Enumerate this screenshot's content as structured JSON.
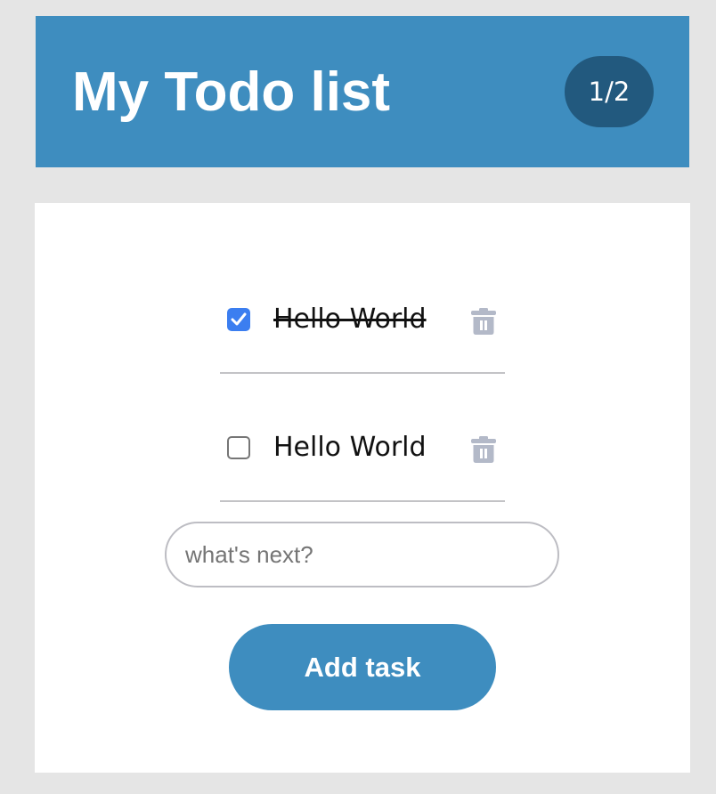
{
  "header": {
    "title": "My Todo list",
    "counter": "1/2"
  },
  "todos": [
    {
      "text": "Hello World",
      "completed": true,
      "checkbox_icon": "checkmark-icon",
      "delete_icon": "trash-icon"
    },
    {
      "text": "Hello World",
      "completed": false,
      "delete_icon": "trash-icon"
    }
  ],
  "new_task": {
    "placeholder": "what's next?",
    "value": ""
  },
  "add_button": {
    "label": "Add task"
  },
  "colors": {
    "page_background": "#e5e5e5",
    "header_background": "#3e8dbf",
    "counter_background": "#22597e",
    "button_background": "#3e8dbf",
    "checkbox_checked": "#3b7ef0",
    "trash_icon": "#b3b9c8",
    "divider": "#c3c3c6"
  }
}
